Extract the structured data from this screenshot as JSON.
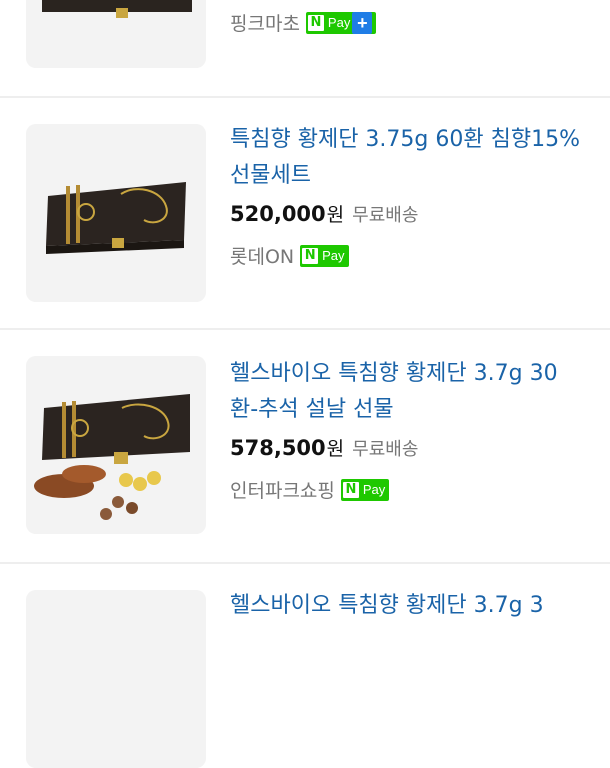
{
  "items": [
    {
      "store": "핑크마초",
      "npay_label": "Pay",
      "npay_plus": "+"
    },
    {
      "title": "특침향 황제단 3.75g 60환 침향15% 선물세트",
      "price": "520,000",
      "currency": "원",
      "shipping": "무료배송",
      "store": "롯데ON",
      "npay_label": "Pay"
    },
    {
      "title": "헬스바이오 특침향 황제단 3.7g 30환-추석 설날 선물",
      "price": "578,500",
      "currency": "원",
      "shipping": "무료배송",
      "store": "인터파크쇼핑",
      "npay_label": "Pay"
    },
    {
      "title": "헬스바이오 특침향 황제단 3.7g 3"
    }
  ],
  "colors": {
    "title": "#1a63a8",
    "npay_green": "#1ec800",
    "npay_plus_blue": "#1f7de6"
  }
}
